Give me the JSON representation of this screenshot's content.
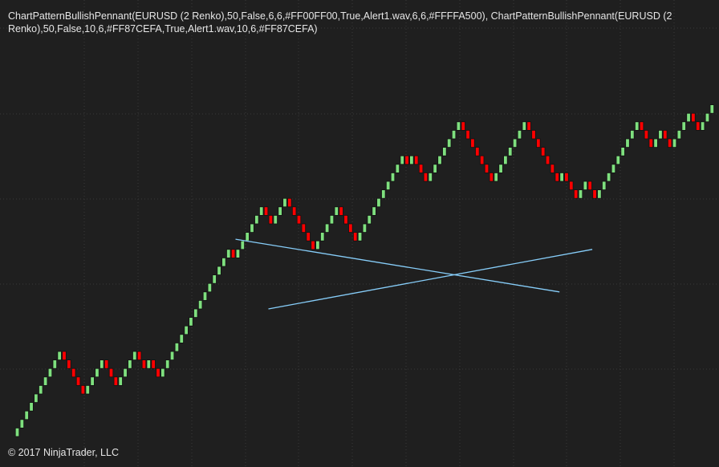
{
  "indicator_label": "ChartPatternBullishPennant(EURUSD (2 Renko),50,False,6,6,#FF00FF00,True,Alert1.wav,6,6,#FFFFA500), ChartPatternBullishPennant(EURUSD (2 Renko),50,False,10,6,#FF87CEFA,True,Alert1.wav,10,6,#FF87CEFA)",
  "copyright": "© 2017 NinjaTrader, LLC",
  "colors": {
    "background": "#1f1f1f",
    "grid": "#3a3a3a",
    "up_brick": "#7fe07f",
    "down_brick": "#ff0000",
    "brick_border": "#111111",
    "pattern_line": "#87cefa",
    "text": "#e6e6e6"
  },
  "chart_data": {
    "type": "renko",
    "title": "",
    "xlabel": "",
    "ylabel": "",
    "grid": true,
    "brick_size_units": 1,
    "ylim": [
      -1,
      49
    ],
    "bricks": [
      {
        "i": 0,
        "top": 1,
        "dir": "up"
      },
      {
        "i": 1,
        "top": 2,
        "dir": "up"
      },
      {
        "i": 2,
        "top": 3,
        "dir": "up"
      },
      {
        "i": 3,
        "top": 4,
        "dir": "up"
      },
      {
        "i": 4,
        "top": 5,
        "dir": "up"
      },
      {
        "i": 5,
        "top": 6,
        "dir": "up"
      },
      {
        "i": 6,
        "top": 7,
        "dir": "up"
      },
      {
        "i": 7,
        "top": 8,
        "dir": "up"
      },
      {
        "i": 8,
        "top": 9,
        "dir": "up"
      },
      {
        "i": 9,
        "top": 10,
        "dir": "up"
      },
      {
        "i": 10,
        "top": 9,
        "dir": "down"
      },
      {
        "i": 11,
        "top": 8,
        "dir": "down"
      },
      {
        "i": 12,
        "top": 7,
        "dir": "down"
      },
      {
        "i": 13,
        "top": 6,
        "dir": "down"
      },
      {
        "i": 14,
        "top": 5,
        "dir": "down"
      },
      {
        "i": 15,
        "top": 6,
        "dir": "up"
      },
      {
        "i": 16,
        "top": 7,
        "dir": "up"
      },
      {
        "i": 17,
        "top": 8,
        "dir": "up"
      },
      {
        "i": 18,
        "top": 9,
        "dir": "up"
      },
      {
        "i": 19,
        "top": 8,
        "dir": "down"
      },
      {
        "i": 20,
        "top": 7,
        "dir": "down"
      },
      {
        "i": 21,
        "top": 6,
        "dir": "down"
      },
      {
        "i": 22,
        "top": 7,
        "dir": "up"
      },
      {
        "i": 23,
        "top": 8,
        "dir": "up"
      },
      {
        "i": 24,
        "top": 9,
        "dir": "up"
      },
      {
        "i": 25,
        "top": 10,
        "dir": "up"
      },
      {
        "i": 26,
        "top": 9,
        "dir": "down"
      },
      {
        "i": 27,
        "top": 8,
        "dir": "down"
      },
      {
        "i": 28,
        "top": 9,
        "dir": "up"
      },
      {
        "i": 29,
        "top": 8,
        "dir": "down"
      },
      {
        "i": 30,
        "top": 7,
        "dir": "down"
      },
      {
        "i": 31,
        "top": 8,
        "dir": "up"
      },
      {
        "i": 32,
        "top": 9,
        "dir": "up"
      },
      {
        "i": 33,
        "top": 10,
        "dir": "up"
      },
      {
        "i": 34,
        "top": 11,
        "dir": "up"
      },
      {
        "i": 35,
        "top": 12,
        "dir": "up"
      },
      {
        "i": 36,
        "top": 13,
        "dir": "up"
      },
      {
        "i": 37,
        "top": 14,
        "dir": "up"
      },
      {
        "i": 38,
        "top": 15,
        "dir": "up"
      },
      {
        "i": 39,
        "top": 16,
        "dir": "up"
      },
      {
        "i": 40,
        "top": 17,
        "dir": "up"
      },
      {
        "i": 41,
        "top": 18,
        "dir": "up"
      },
      {
        "i": 42,
        "top": 19,
        "dir": "up"
      },
      {
        "i": 43,
        "top": 20,
        "dir": "up"
      },
      {
        "i": 44,
        "top": 21,
        "dir": "up"
      },
      {
        "i": 45,
        "top": 22,
        "dir": "up"
      },
      {
        "i": 46,
        "top": 21,
        "dir": "down"
      },
      {
        "i": 47,
        "top": 22,
        "dir": "up"
      },
      {
        "i": 48,
        "top": 23,
        "dir": "up"
      },
      {
        "i": 49,
        "top": 24,
        "dir": "up"
      },
      {
        "i": 50,
        "top": 25,
        "dir": "up"
      },
      {
        "i": 51,
        "top": 26,
        "dir": "up"
      },
      {
        "i": 52,
        "top": 27,
        "dir": "up"
      },
      {
        "i": 53,
        "top": 26,
        "dir": "down"
      },
      {
        "i": 54,
        "top": 25,
        "dir": "down"
      },
      {
        "i": 55,
        "top": 26,
        "dir": "up"
      },
      {
        "i": 56,
        "top": 27,
        "dir": "up"
      },
      {
        "i": 57,
        "top": 28,
        "dir": "up"
      },
      {
        "i": 58,
        "top": 27,
        "dir": "down"
      },
      {
        "i": 59,
        "top": 26,
        "dir": "down"
      },
      {
        "i": 60,
        "top": 25,
        "dir": "down"
      },
      {
        "i": 61,
        "top": 24,
        "dir": "down"
      },
      {
        "i": 62,
        "top": 23,
        "dir": "down"
      },
      {
        "i": 63,
        "top": 22,
        "dir": "down"
      },
      {
        "i": 64,
        "top": 23,
        "dir": "up"
      },
      {
        "i": 65,
        "top": 24,
        "dir": "up"
      },
      {
        "i": 66,
        "top": 25,
        "dir": "up"
      },
      {
        "i": 67,
        "top": 26,
        "dir": "up"
      },
      {
        "i": 68,
        "top": 27,
        "dir": "up"
      },
      {
        "i": 69,
        "top": 26,
        "dir": "down"
      },
      {
        "i": 70,
        "top": 25,
        "dir": "down"
      },
      {
        "i": 71,
        "top": 24,
        "dir": "down"
      },
      {
        "i": 72,
        "top": 23,
        "dir": "down"
      },
      {
        "i": 73,
        "top": 24,
        "dir": "up"
      },
      {
        "i": 74,
        "top": 25,
        "dir": "up"
      },
      {
        "i": 75,
        "top": 26,
        "dir": "up"
      },
      {
        "i": 76,
        "top": 27,
        "dir": "up"
      },
      {
        "i": 77,
        "top": 28,
        "dir": "up"
      },
      {
        "i": 78,
        "top": 29,
        "dir": "up"
      },
      {
        "i": 79,
        "top": 30,
        "dir": "up"
      },
      {
        "i": 80,
        "top": 31,
        "dir": "up"
      },
      {
        "i": 81,
        "top": 32,
        "dir": "up"
      },
      {
        "i": 82,
        "top": 33,
        "dir": "up"
      },
      {
        "i": 83,
        "top": 32,
        "dir": "down"
      },
      {
        "i": 84,
        "top": 33,
        "dir": "up"
      },
      {
        "i": 85,
        "top": 32,
        "dir": "down"
      },
      {
        "i": 86,
        "top": 31,
        "dir": "down"
      },
      {
        "i": 87,
        "top": 30,
        "dir": "down"
      },
      {
        "i": 88,
        "top": 31,
        "dir": "up"
      },
      {
        "i": 89,
        "top": 32,
        "dir": "up"
      },
      {
        "i": 90,
        "top": 33,
        "dir": "up"
      },
      {
        "i": 91,
        "top": 34,
        "dir": "up"
      },
      {
        "i": 92,
        "top": 35,
        "dir": "up"
      },
      {
        "i": 93,
        "top": 36,
        "dir": "up"
      },
      {
        "i": 94,
        "top": 37,
        "dir": "up"
      },
      {
        "i": 95,
        "top": 36,
        "dir": "down"
      },
      {
        "i": 96,
        "top": 35,
        "dir": "down"
      },
      {
        "i": 97,
        "top": 34,
        "dir": "down"
      },
      {
        "i": 98,
        "top": 33,
        "dir": "down"
      },
      {
        "i": 99,
        "top": 32,
        "dir": "down"
      },
      {
        "i": 100,
        "top": 31,
        "dir": "down"
      },
      {
        "i": 101,
        "top": 30,
        "dir": "down"
      },
      {
        "i": 102,
        "top": 31,
        "dir": "up"
      },
      {
        "i": 103,
        "top": 32,
        "dir": "up"
      },
      {
        "i": 104,
        "top": 33,
        "dir": "up"
      },
      {
        "i": 105,
        "top": 34,
        "dir": "up"
      },
      {
        "i": 106,
        "top": 35,
        "dir": "up"
      },
      {
        "i": 107,
        "top": 36,
        "dir": "up"
      },
      {
        "i": 108,
        "top": 37,
        "dir": "up"
      },
      {
        "i": 109,
        "top": 36,
        "dir": "down"
      },
      {
        "i": 110,
        "top": 35,
        "dir": "down"
      },
      {
        "i": 111,
        "top": 34,
        "dir": "down"
      },
      {
        "i": 112,
        "top": 33,
        "dir": "down"
      },
      {
        "i": 113,
        "top": 32,
        "dir": "down"
      },
      {
        "i": 114,
        "top": 31,
        "dir": "down"
      },
      {
        "i": 115,
        "top": 30,
        "dir": "down"
      },
      {
        "i": 116,
        "top": 31,
        "dir": "up"
      },
      {
        "i": 117,
        "top": 30,
        "dir": "down"
      },
      {
        "i": 118,
        "top": 29,
        "dir": "down"
      },
      {
        "i": 119,
        "top": 28,
        "dir": "down"
      },
      {
        "i": 120,
        "top": 29,
        "dir": "up"
      },
      {
        "i": 121,
        "top": 30,
        "dir": "up"
      },
      {
        "i": 122,
        "top": 29,
        "dir": "down"
      },
      {
        "i": 123,
        "top": 28,
        "dir": "down"
      },
      {
        "i": 124,
        "top": 29,
        "dir": "up"
      },
      {
        "i": 125,
        "top": 30,
        "dir": "up"
      },
      {
        "i": 126,
        "top": 31,
        "dir": "up"
      },
      {
        "i": 127,
        "top": 32,
        "dir": "up"
      },
      {
        "i": 128,
        "top": 33,
        "dir": "up"
      },
      {
        "i": 129,
        "top": 34,
        "dir": "up"
      },
      {
        "i": 130,
        "top": 35,
        "dir": "up"
      },
      {
        "i": 131,
        "top": 36,
        "dir": "up"
      },
      {
        "i": 132,
        "top": 37,
        "dir": "up"
      },
      {
        "i": 133,
        "top": 36,
        "dir": "down"
      },
      {
        "i": 134,
        "top": 35,
        "dir": "down"
      },
      {
        "i": 135,
        "top": 34,
        "dir": "down"
      },
      {
        "i": 136,
        "top": 35,
        "dir": "up"
      },
      {
        "i": 137,
        "top": 36,
        "dir": "up"
      },
      {
        "i": 138,
        "top": 35,
        "dir": "down"
      },
      {
        "i": 139,
        "top": 34,
        "dir": "down"
      },
      {
        "i": 140,
        "top": 35,
        "dir": "up"
      },
      {
        "i": 141,
        "top": 36,
        "dir": "up"
      },
      {
        "i": 142,
        "top": 37,
        "dir": "up"
      },
      {
        "i": 143,
        "top": 38,
        "dir": "up"
      },
      {
        "i": 144,
        "top": 37,
        "dir": "down"
      },
      {
        "i": 145,
        "top": 36,
        "dir": "down"
      },
      {
        "i": 146,
        "top": 37,
        "dir": "up"
      },
      {
        "i": 147,
        "top": 38,
        "dir": "up"
      },
      {
        "i": 148,
        "top": 39,
        "dir": "up"
      }
    ],
    "pattern_lines": [
      {
        "name": "",
        "x": [
          46.5,
          115.5
        ],
        "y": [
          23.2,
          17.0
        ]
      },
      {
        "name": "",
        "x": [
          53.5,
          122.5
        ],
        "y": [
          15.0,
          22.0
        ]
      }
    ]
  }
}
